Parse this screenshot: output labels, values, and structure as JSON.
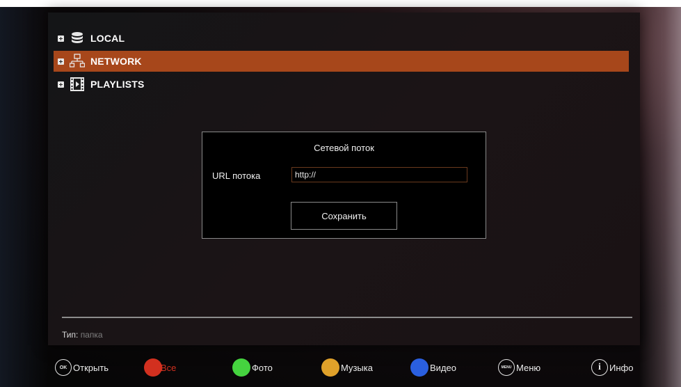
{
  "tree": {
    "items": [
      {
        "label": "LOCAL",
        "icon": "database-icon"
      },
      {
        "label": "NETWORK",
        "icon": "network-icon"
      },
      {
        "label": "PLAYLISTS",
        "icon": "film-icon"
      }
    ],
    "selected_index": 1
  },
  "dialog": {
    "title": "Сетевой поток",
    "url_label": "URL потока",
    "url_value": "http://",
    "save_label": "Сохранить"
  },
  "info": {
    "key": "Тип:",
    "value": "папка"
  },
  "footer": {
    "ok_glyph": "OK",
    "open_label": "Открыть",
    "all_label": "Все",
    "photo_label": "Фото",
    "music_label": "Музыка",
    "video_label": "Видео",
    "menu_glyph": "MENU",
    "menu_label": "Меню",
    "info_glyph": "i",
    "info_label": "Инфо"
  },
  "colors": {
    "selected_row": "#a7471b",
    "red": "#d2301f",
    "green": "#45d33f",
    "yellow": "#e0a12a",
    "blue": "#2a5fe0"
  }
}
